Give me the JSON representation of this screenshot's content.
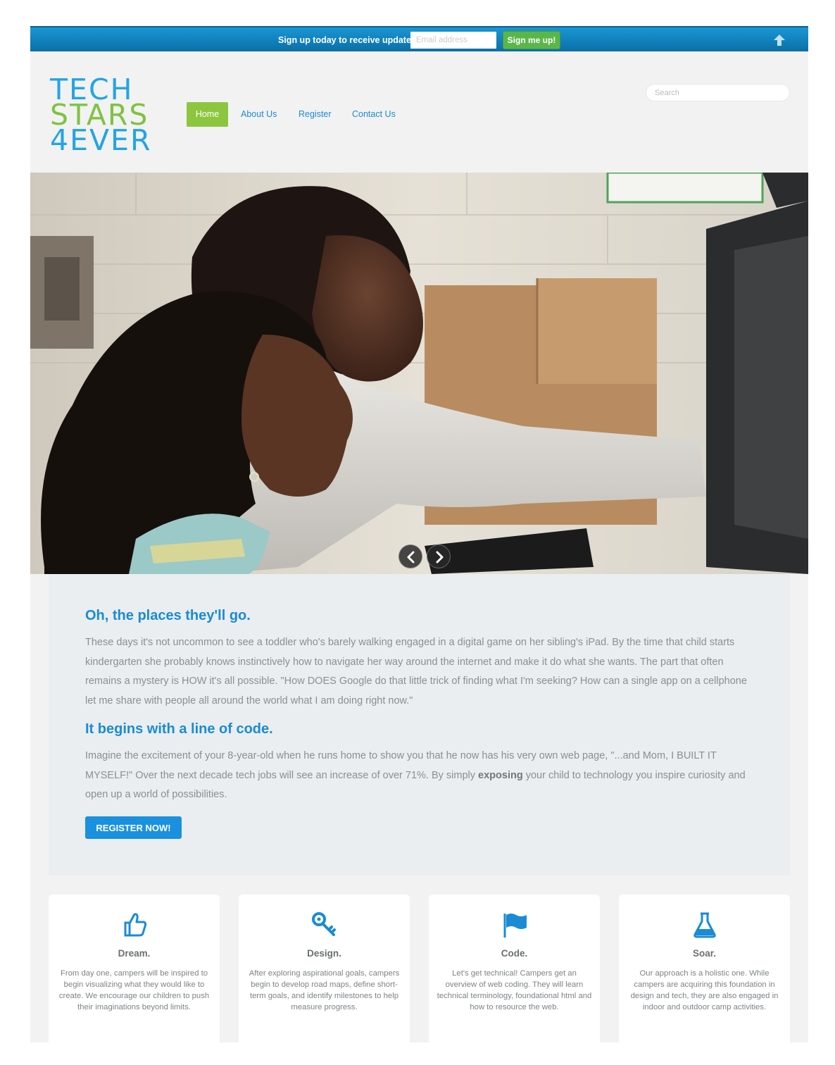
{
  "topbar": {
    "signup_text": "Sign up today to receive updates!",
    "email_placeholder": "Email address",
    "signup_button": "Sign me up!"
  },
  "logo": {
    "line1": "TECH",
    "line2": "STARS",
    "line3": "4EVER"
  },
  "nav": {
    "items": [
      "Home",
      "About Us",
      "Register",
      "Contact Us"
    ],
    "active": "Home"
  },
  "search": {
    "placeholder": "Search"
  },
  "intro": {
    "heading1": "Oh, the places they'll go.",
    "paragraph1": "These days it's not uncommon to see a toddler who's barely walking engaged in a digital game on her sibling's iPad. By the time that child starts kindergarten she probably knows instinctively how to navigate her way around the internet and make it do what she wants. The part that often remains a mystery is HOW it's all possible. \"How DOES Google do that little trick of finding what I'm seeking? How can a single app on a cellphone let me share with people all around the world what I am doing right now.\"",
    "heading2": "It begins with a line of code.",
    "paragraph2_before": "Imagine the excitement of your 8-year-old when he runs home to show you that he now has his very own web page, \"...and Mom, I BUILT IT MYSELF!\" Over the next decade tech jobs will see an increase of over 71%. By simply ",
    "paragraph2_bold": "exposing",
    "paragraph2_after": " your child to technology you inspire curiosity and open up a world of possibilities.",
    "register_button": "REGISTER NOW!"
  },
  "features": [
    {
      "icon": "thumbs-up-icon",
      "title": "Dream.",
      "text": "From day one, campers will be inspired to begin visualizing what they would like to create. We encourage our children to push their imaginations beyond limits."
    },
    {
      "icon": "key-icon",
      "title": "Design.",
      "text": "After exploring aspirational goals, campers begin to develop road maps, define short-term goals, and identify milestones to help measure progress."
    },
    {
      "icon": "flag-icon",
      "title": "Code.",
      "text": "Let's get technical! Campers get an overview of web coding. They will learn technical terminology, foundational html and how to resource the web."
    },
    {
      "icon": "flask-icon",
      "title": "Soar.",
      "text": "Our approach is a holistic one. While campers are acquiring this foundation in design and tech, they are also engaged in indoor and outdoor camp activities."
    }
  ],
  "colors": {
    "accent_blue": "#1a8bd4",
    "accent_green": "#8cc63f",
    "topbar_blue": "#0a6ea8"
  }
}
